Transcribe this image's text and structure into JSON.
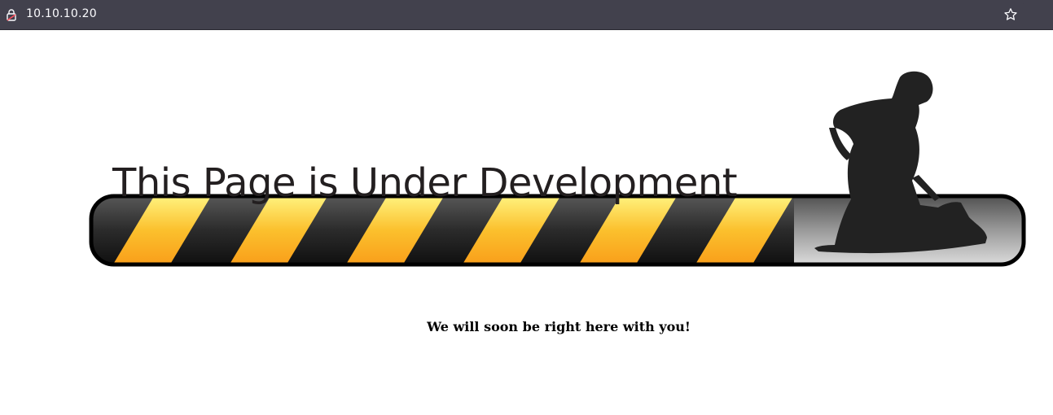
{
  "browser": {
    "url": "10.10.10.20",
    "lock_icon": "lock-icon",
    "bookmark_icon": "star-icon"
  },
  "page": {
    "banner_title": "This Page is Under Development",
    "tagline": "We will soon be right here with you!",
    "colors": {
      "stripe_yellow": "#fbc02d",
      "stripe_dark": "#2b2b2b",
      "figure": "#222222",
      "frame": "#000000"
    }
  }
}
